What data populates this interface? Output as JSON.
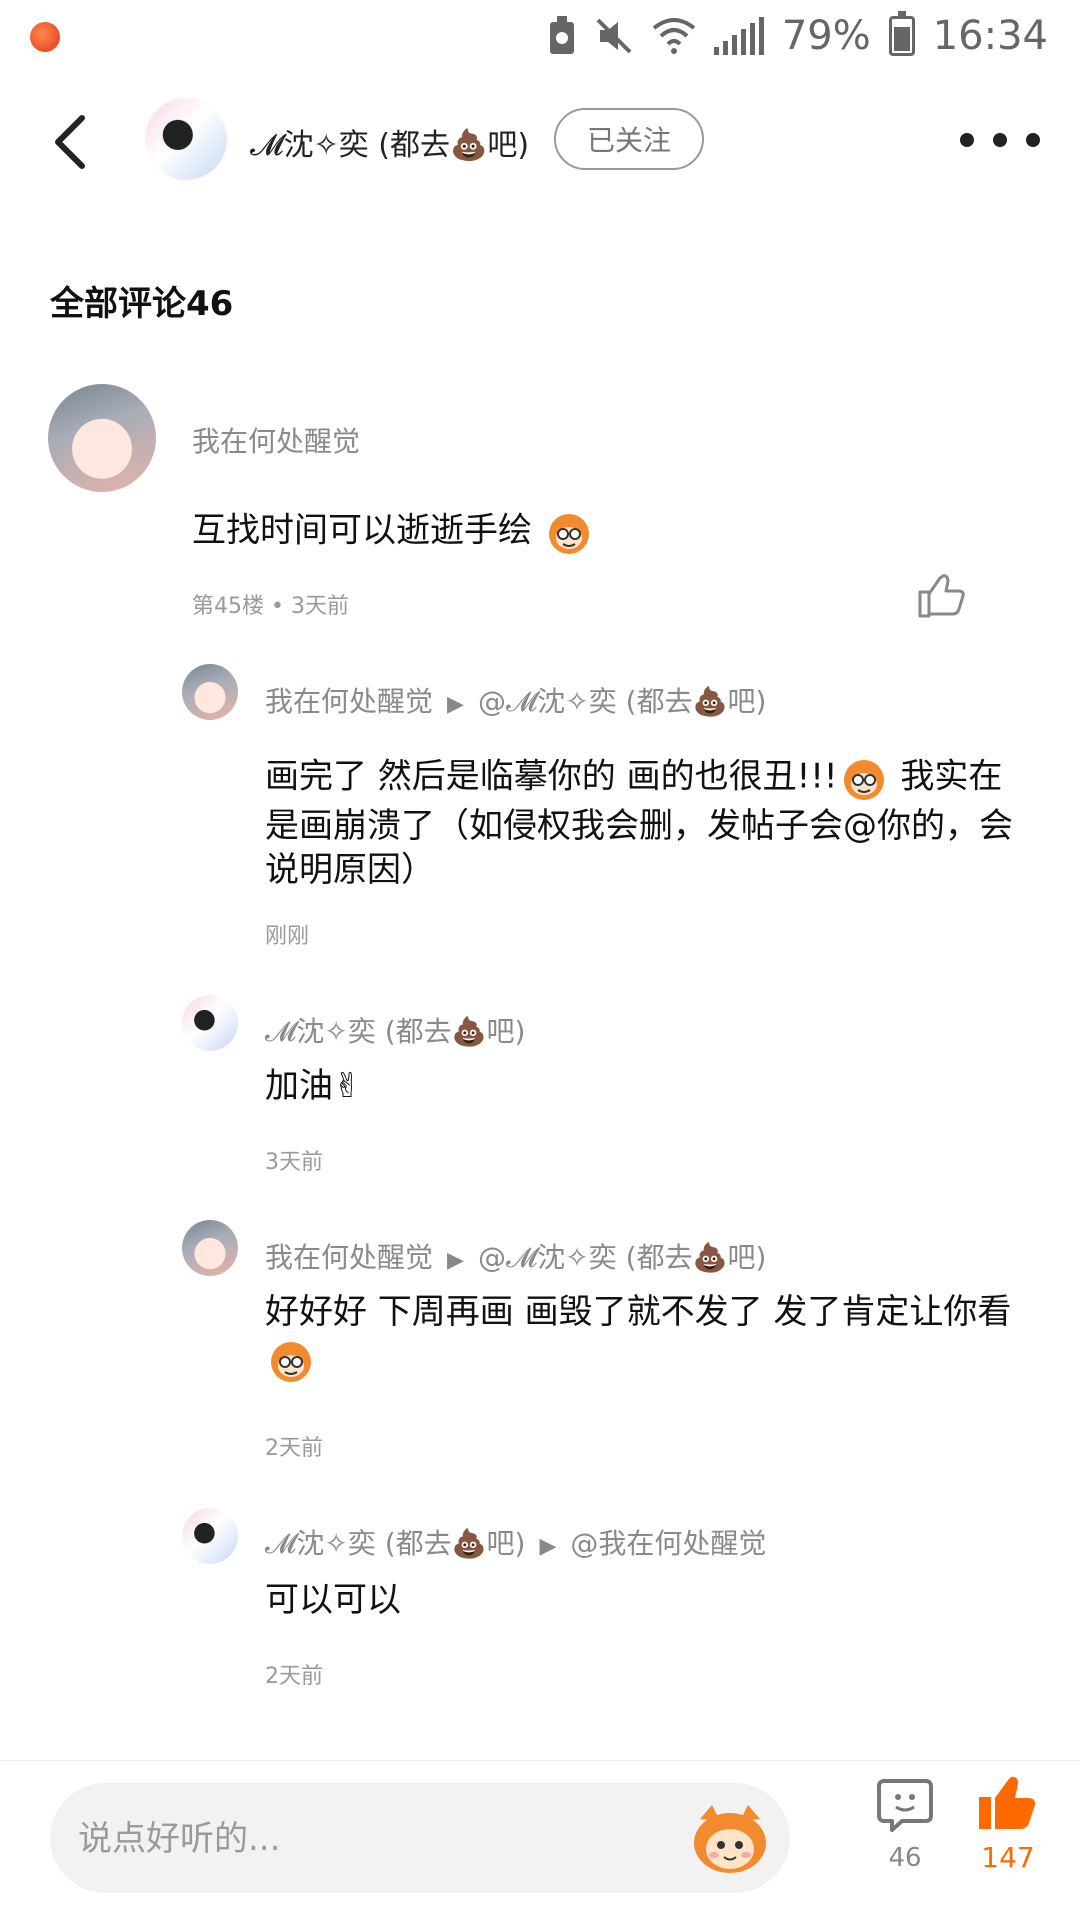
{
  "status_bar": {
    "battery_level": "79%",
    "time": "16:34"
  },
  "header": {
    "user_name": "𝓜沈✧奕 (都去💩吧)",
    "follow_label": "已关注"
  },
  "section_title": "全部评论46",
  "comments": [
    {
      "user": "我在何处醒觉",
      "text": "互找时间可以逝逝手绘",
      "floor": "第45楼 • 3天前"
    }
  ],
  "replies": [
    {
      "user": "我在何处醒觉",
      "reply_to": "@𝓜沈✧奕 (都去💩吧)",
      "text_part1": "画完了 然后是临摹你的 画的也很丑!!!",
      "text_part2": " 我实在是画崩溃了（如侵权我会删，发帖子会@你的，会说明原因）",
      "time": "刚刚"
    },
    {
      "user": "𝓜沈✧奕 (都去💩吧)",
      "text": "加油✌",
      "time": "3天前"
    },
    {
      "user": "我在何处醒觉",
      "reply_to": "@𝓜沈✧奕 (都去💩吧)",
      "text": "好好好 下周再画 画毁了就不发了 发了肯定让你看",
      "time": "2天前"
    },
    {
      "user": "𝓜沈✧奕 (都去💩吧)",
      "reply_to": "@我在何处醒觉",
      "text": "可以可以",
      "time": "2天前"
    }
  ],
  "bottom_bar": {
    "input_placeholder": "说点好听的...",
    "comment_count": "46",
    "like_count": "147"
  },
  "colors": {
    "accent": "#ff6a00",
    "muted_text": "#8a8a8a"
  }
}
